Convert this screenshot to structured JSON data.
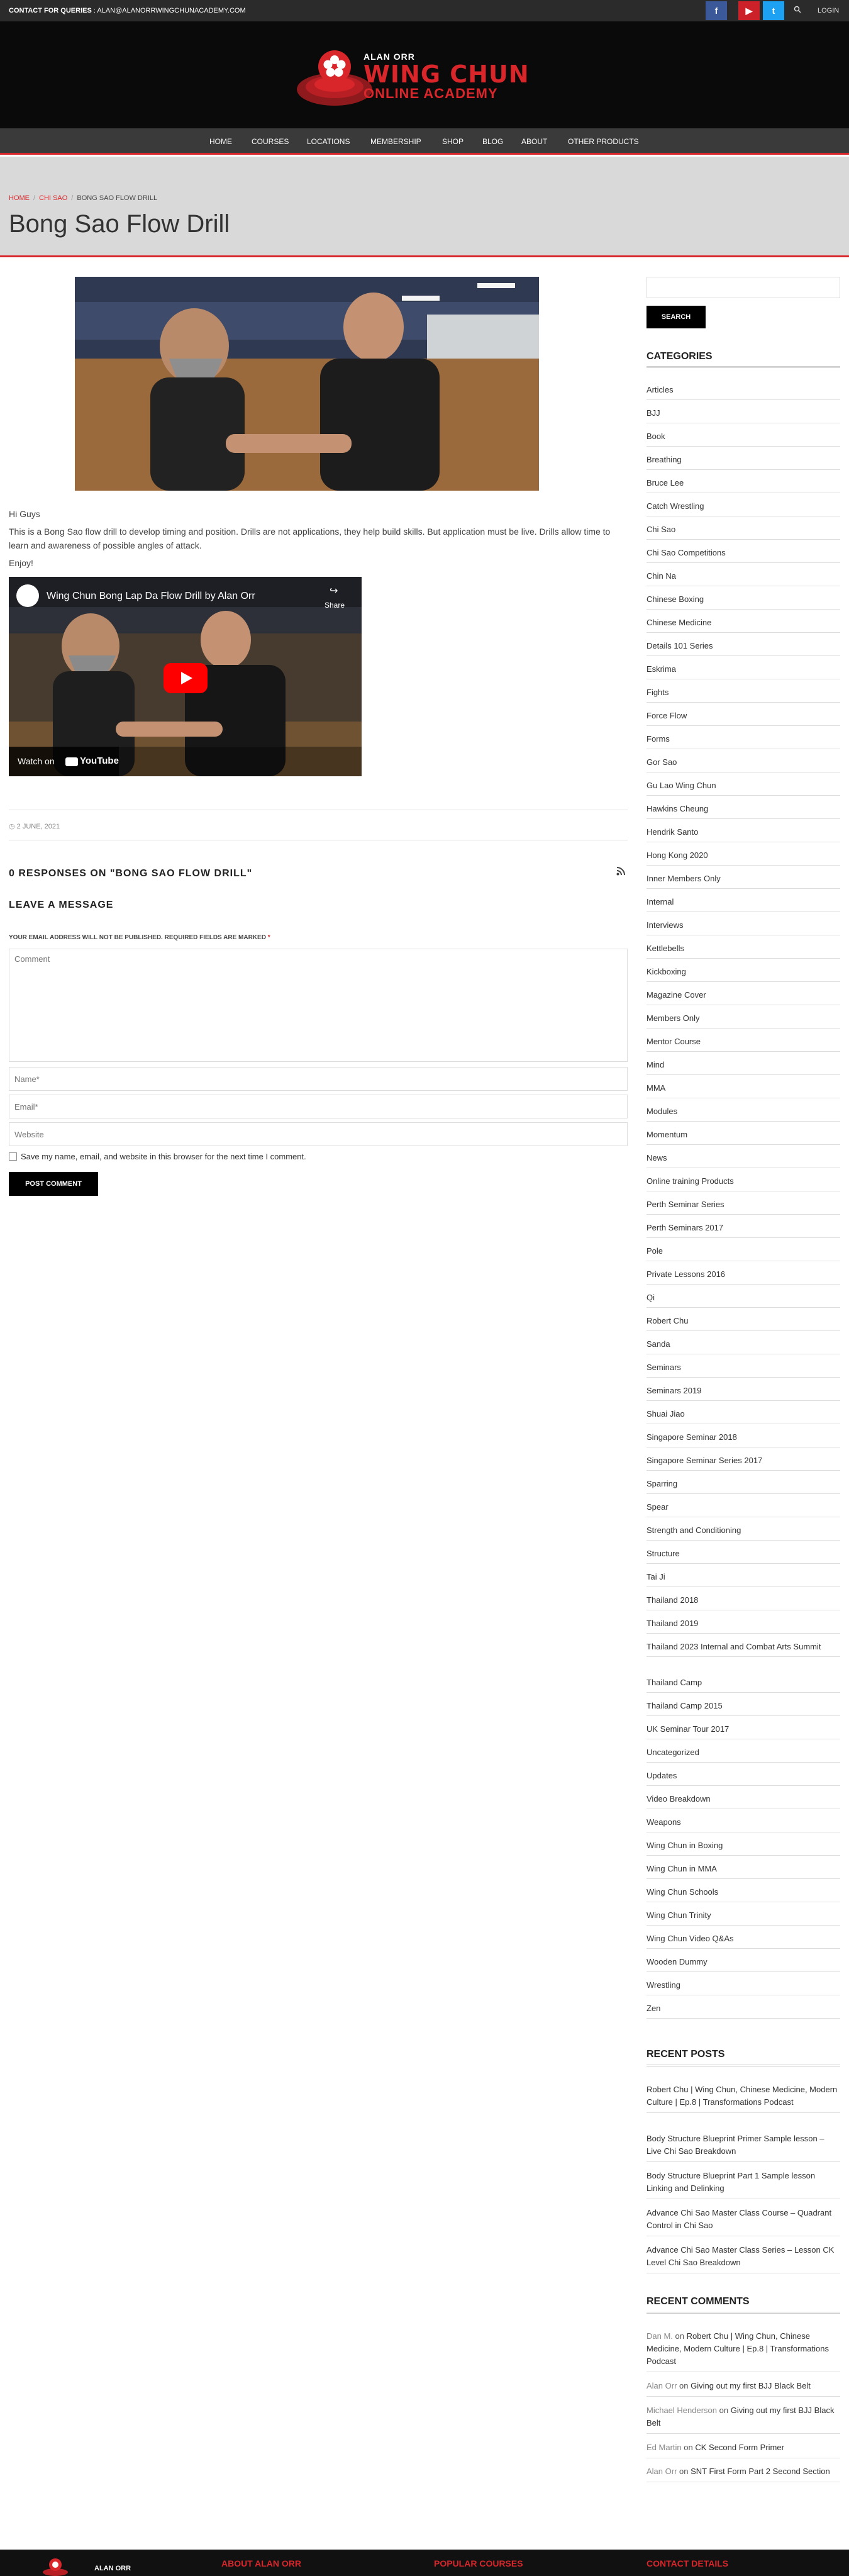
{
  "topbar": {
    "contact_label": "CONTACT FOR QUERIES",
    "contact_email": "ALAN@ALANORRWINGCHUNACADEMY.COM",
    "login": "LOGIN",
    "facebook": "f",
    "youtube": "▶",
    "twitter": "t",
    "colors": {
      "facebook": "#3b5998",
      "youtube": "#cc2128",
      "twitter": "#1da1f2"
    }
  },
  "logo": {
    "line1": "ALAN ORR",
    "line2": "WING CHUN",
    "line3": "ONLINE ACADEMY"
  },
  "nav": {
    "items": [
      "HOME",
      "COURSES",
      "LOCATIONS",
      "MEMBERSHIP",
      "SHOP",
      "BLOG",
      "ABOUT",
      "OTHER PRODUCTS"
    ]
  },
  "breadcrumb": {
    "home": "HOME",
    "category": "CHI SAO",
    "current": "BONG SAO FLOW DRILL"
  },
  "page": {
    "title": "Bong Sao Flow Drill"
  },
  "article": {
    "greeting": "Hi Guys",
    "body": "This is a Bong Sao flow drill to develop timing and position. Drills are not applications, they help build skills. But application must be live. Drills allow time to learn and awareness of possible angles of attack.",
    "sign_off": "Enjoy!",
    "video_title": "Wing Chun Bong Lap Da Flow Drill by Alan Orr",
    "video_share": "Share",
    "video_watch": "Watch on",
    "video_brand": "YouTube",
    "date": "2 JUNE, 2021"
  },
  "comments": {
    "responses_heading": "0 RESPONSES ON \"BONG SAO FLOW DRILL\"",
    "leave_heading": "LEAVE A MESSAGE",
    "note": "YOUR EMAIL ADDRESS WILL NOT BE PUBLISHED. REQUIRED FIELDS ARE MARKED",
    "required_mark": "*",
    "comment_placeholder": "Comment",
    "name_placeholder": "Name*",
    "email_placeholder": "Email*",
    "website_placeholder": "Website",
    "save_label": "Save my name, email, and website in this browser for the next time I comment.",
    "post_button": "POST COMMENT"
  },
  "sidebar": {
    "search_button": "SEARCH",
    "categories_heading": "CATEGORIES",
    "categories": [
      "Articles",
      "BJJ",
      "Book",
      "Breathing",
      "Bruce Lee",
      "Catch Wrestling",
      "Chi Sao",
      "Chi Sao Competitions",
      "Chin Na",
      "Chinese Boxing",
      "Chinese Medicine",
      "Details 101 Series",
      "Eskrima",
      "Fights",
      "Force Flow",
      "Forms",
      "Gor Sao",
      "Gu Lao Wing Chun",
      "Hawkins Cheung",
      "Hendrik Santo",
      "Hong Kong 2020",
      "Inner Members Only",
      "Internal",
      "Interviews",
      "Kettlebells",
      "Kickboxing",
      "Magazine Cover",
      "Members Only",
      "Mentor Course",
      "Mind",
      "MMA",
      "Modules",
      "Momentum",
      "News",
      "Online training Products",
      "Perth Seminar Series",
      "Perth Seminars 2017",
      "Pole",
      "Private Lessons 2016",
      "Qi",
      "Robert Chu",
      "Sanda",
      "Seminars",
      "Seminars 2019",
      "Shuai Jiao",
      "Singapore Seminar 2018",
      "Singapore Seminar Series 2017",
      "Sparring",
      "Spear",
      "Strength and Conditioning",
      "Structure",
      "Tai Ji",
      "Thailand 2018",
      "Thailand 2019",
      "Thailand 2023 Internal and Combat Arts Summit",
      "Thailand Camp",
      "Thailand Camp 2015",
      "UK Seminar Tour 2017",
      "Uncategorized",
      "Updates",
      "Video Breakdown",
      "Weapons",
      "Wing Chun in Boxing",
      "Wing Chun in MMA",
      "Wing Chun Schools",
      "Wing Chun Trinity",
      "Wing Chun Video Q&As",
      "Wooden Dummy",
      "Wrestling",
      "Zen"
    ],
    "recent_posts_heading": "RECENT POSTS",
    "recent_posts": [
      "Robert Chu | Wing Chun, Chinese Medicine, Modern Culture | Ep.8 | Transformations Podcast",
      "Body Structure Blueprint Primer Sample lesson – Live Chi Sao Breakdown",
      "Body Structure Blueprint Part 1 Sample lesson Linking and Delinking",
      "Advance Chi Sao Master Class Course – Quadrant Control in Chi Sao",
      "Advance Chi Sao Master Class Series – Lesson CK Level Chi Sao Breakdown"
    ],
    "recent_comments_heading": "RECENT COMMENTS",
    "recent_comments": [
      {
        "author": "Dan M.",
        "on": "on",
        "post": "Robert Chu | Wing Chun, Chinese Medicine, Modern Culture | Ep.8 | Transformations Podcast"
      },
      {
        "author": "Alan Orr",
        "on": "on",
        "post": "Giving out my first BJJ Black Belt"
      },
      {
        "author": "Michael Henderson",
        "on": "on",
        "post": "Giving out my first BJJ Black Belt"
      },
      {
        "author": "Ed Martin",
        "on": "on",
        "post": "CK Second Form Primer"
      },
      {
        "author": "Alan Orr",
        "on": "on",
        "post": "SNT First Form Part 2 Second Section"
      }
    ]
  },
  "footer": {
    "name": "ALAN ORR",
    "about": "ABOUT ALAN ORR",
    "courses": "POPULAR COURSES",
    "contact": "CONTACT DETAILS"
  },
  "colors": {
    "accent": "#d9262b",
    "dark": "#0a0a0a",
    "nav": "#3a3a3a"
  }
}
